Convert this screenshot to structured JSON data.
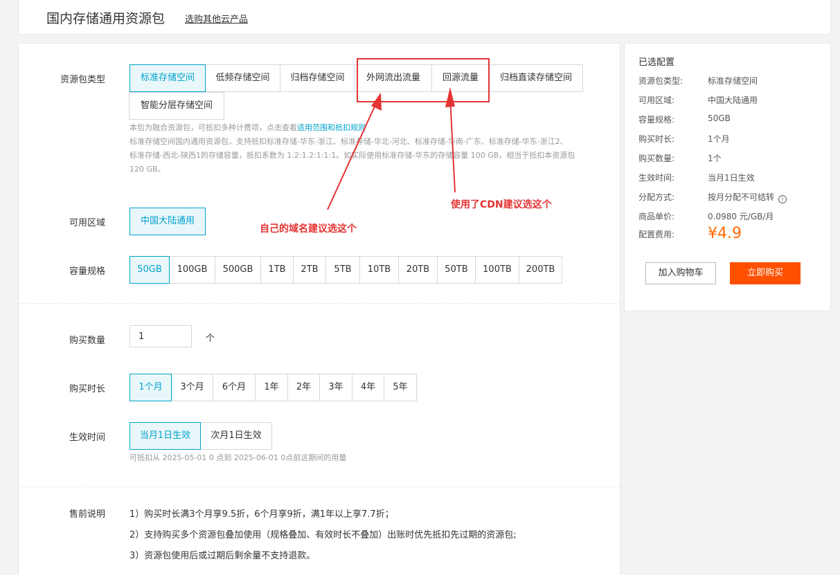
{
  "header": {
    "title": "国内存储通用资源包",
    "other_link": "选购其他云产品"
  },
  "pkg_type": {
    "label": "资源包类型",
    "options": [
      "标准存储空间",
      "低频存储空间",
      "归档存储空间",
      "外网流出流量",
      "回源流量",
      "归档直读存储空间",
      "智能分层存储空间"
    ],
    "selected": "标准存储空间",
    "note_prefix": "本包为融合资源包，可抵扣多种计费项，点击查看",
    "note_link": "适用范围和抵扣规则",
    "note_line2": "标准存储空间国内通用资源包，支持抵扣标准存储-华东-浙江、标准存储-华北-河北、标准存储-华南-广东、标准存储-华东-浙江2、",
    "note_line3": "标准存储-西北-陕西1的存储容量，抵扣系数为 1.2:1.2:1:1:1。如实际使用标准存储-华东的存储容量 100 GB，相当于抵扣本资源包",
    "note_line4": "120 GB。"
  },
  "region": {
    "label": "可用区域",
    "options": [
      "中国大陆通用"
    ],
    "selected": "中国大陆通用"
  },
  "capacity": {
    "label": "容量规格",
    "options": [
      "50GB",
      "100GB",
      "500GB",
      "1TB",
      "2TB",
      "5TB",
      "10TB",
      "20TB",
      "50TB",
      "100TB",
      "200TB"
    ],
    "selected": "50GB"
  },
  "quantity": {
    "label": "购买数量",
    "value": "1",
    "unit": "个"
  },
  "duration": {
    "label": "购买时长",
    "options": [
      "1个月",
      "3个月",
      "6个月",
      "1年",
      "2年",
      "3年",
      "4年",
      "5年"
    ],
    "selected": "1个月"
  },
  "effective": {
    "label": "生效时间",
    "options": [
      "当月1日生效",
      "次月1日生效"
    ],
    "selected": "当月1日生效",
    "note": "可抵扣从 2025-05-01 0 点到 2025-06-01 0点前这期间的用量"
  },
  "presale": {
    "label": "售前说明",
    "lines": [
      "1）购买时长满3个月享9.5折，6个月享9折，满1年以上享7.7折；",
      "2）支持购买多个资源包叠加使用（规格叠加、有效时长不叠加）出账时优先抵扣先过期的资源包;",
      "3）资源包使用后或过期后剩余量不支持退款。"
    ]
  },
  "summary": {
    "title": "已选配置",
    "rows": [
      {
        "k": "资源包类型:",
        "v": "标准存储空间"
      },
      {
        "k": "可用区域:",
        "v": "中国大陆通用"
      },
      {
        "k": "容量规格:",
        "v": "50GB"
      },
      {
        "k": "购买时长:",
        "v": "1个月"
      },
      {
        "k": "购买数量:",
        "v": "1个"
      },
      {
        "k": "生效时间:",
        "v": "当月1日生效"
      },
      {
        "k": "分配方式:",
        "v": "按月分配不可结转"
      },
      {
        "k": "商品单价:",
        "v": "0.0980 元/GB/月"
      }
    ],
    "fee_label": "配置费用:",
    "fee": "¥4.9",
    "cart_button": "加入购物车",
    "buy_button": "立即购买"
  },
  "annotations": {
    "left_text": "自己的域名建议选这个",
    "right_text": "使用了CDN建议选这个"
  },
  "colors": {
    "accent": "#00a2ca",
    "price": "#ff6a00",
    "buy": "#ff5000",
    "annotation": "#e53333"
  }
}
